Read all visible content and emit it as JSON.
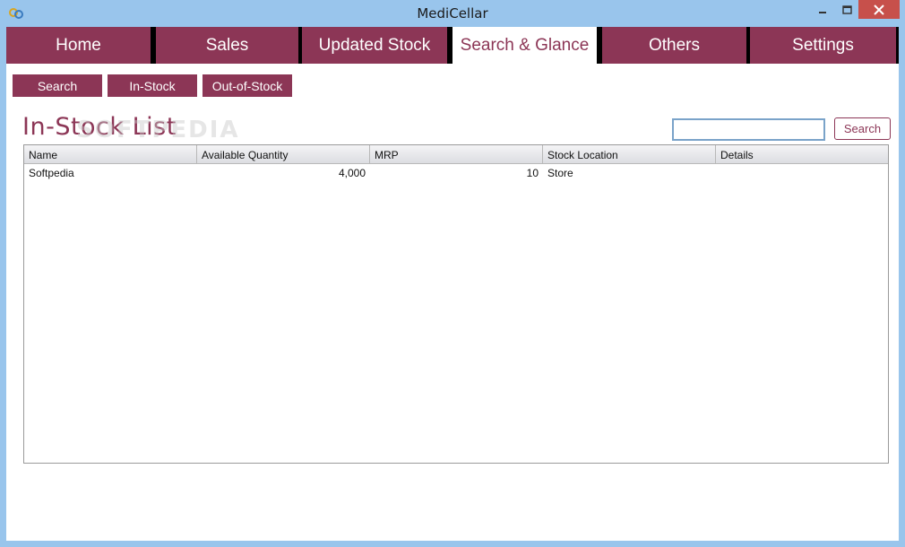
{
  "window": {
    "title": "MediCellar"
  },
  "tabs": [
    {
      "label": "Home"
    },
    {
      "label": "Sales"
    },
    {
      "label": "Updated Stock"
    },
    {
      "label": "Search & Glance"
    },
    {
      "label": "Others"
    },
    {
      "label": "Settings"
    }
  ],
  "active_tab": "Search & Glance",
  "subnav": [
    {
      "label": "Search"
    },
    {
      "label": "In-Stock"
    },
    {
      "label": "Out-of-Stock"
    }
  ],
  "page": {
    "heading": "In-Stock  List",
    "watermark": "SOFTPEDIA"
  },
  "search": {
    "value": "",
    "button_label": "Search"
  },
  "table": {
    "columns": [
      "Name",
      "Available Quantity",
      "MRP",
      "Stock Location",
      "Details"
    ],
    "rows": [
      [
        "Softpedia",
        "4,000",
        "10",
        "Store",
        ""
      ]
    ]
  },
  "colors": {
    "accent": "#8c3656",
    "titlebar": "#99c5ec",
    "close_button": "#c7504b"
  },
  "icons": {
    "app": "app-icon",
    "minimize": "minimize-icon",
    "maximize": "maximize-icon",
    "close": "close-icon"
  }
}
